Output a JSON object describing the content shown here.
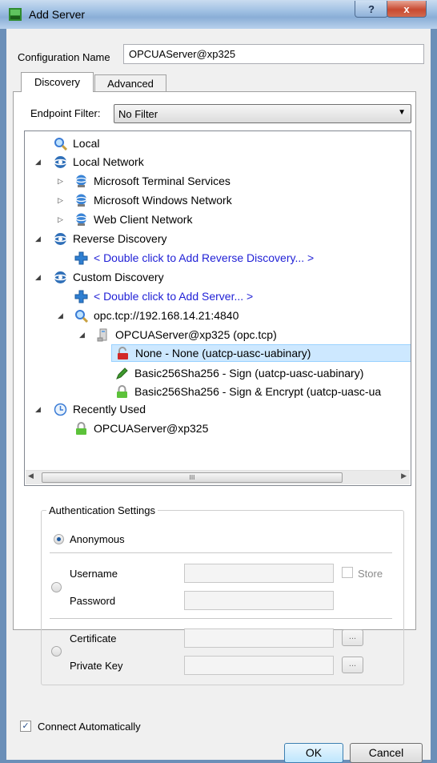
{
  "window": {
    "title": "Add Server",
    "help_glyph": "?",
    "close_glyph": "x"
  },
  "config": {
    "label": "Configuration Name",
    "value": "OPCUAServer@xp325"
  },
  "tabs": [
    {
      "label": "Discovery",
      "active": true
    },
    {
      "label": "Advanced",
      "active": false
    }
  ],
  "filter": {
    "label": "Endpoint Filter:",
    "value": "No Filter"
  },
  "tree": {
    "local": "Local",
    "local_network": "Local Network",
    "terminal_services": "Microsoft Terminal Services",
    "windows_network": "Microsoft Windows Network",
    "web_client": "Web Client Network",
    "reverse_discovery": "Reverse Discovery",
    "add_reverse": "< Double click to Add Reverse Discovery... >",
    "custom_discovery": "Custom Discovery",
    "add_server": "< Double click to Add Server... >",
    "endpoint_url": "opc.tcp://192.168.14.21:4840",
    "server": "OPCUAServer@xp325 (opc.tcp)",
    "ep_none": "None - None (uatcp-uasc-uabinary)",
    "ep_sign": "Basic256Sha256 - Sign (uatcp-uasc-uabinary)",
    "ep_encrypt": "Basic256Sha256 - Sign & Encrypt (uatcp-uasc-ua",
    "recently_used": "Recently Used",
    "recent_server": "OPCUAServer@xp325"
  },
  "scrollbar": {
    "thumb_glyph": "III"
  },
  "auth": {
    "title": "Authentication Settings",
    "anonymous": "Anonymous",
    "username": "Username",
    "password": "Password",
    "store": "Store",
    "certificate": "Certificate",
    "private_key": "Private Key",
    "browse": "..."
  },
  "connect_auto": {
    "label": "Connect Automatically",
    "checked": true
  },
  "buttons": {
    "ok": "OK",
    "cancel": "Cancel"
  },
  "colors": {
    "link_blue": "#1f1fd6",
    "selection": "#cde8ff"
  }
}
